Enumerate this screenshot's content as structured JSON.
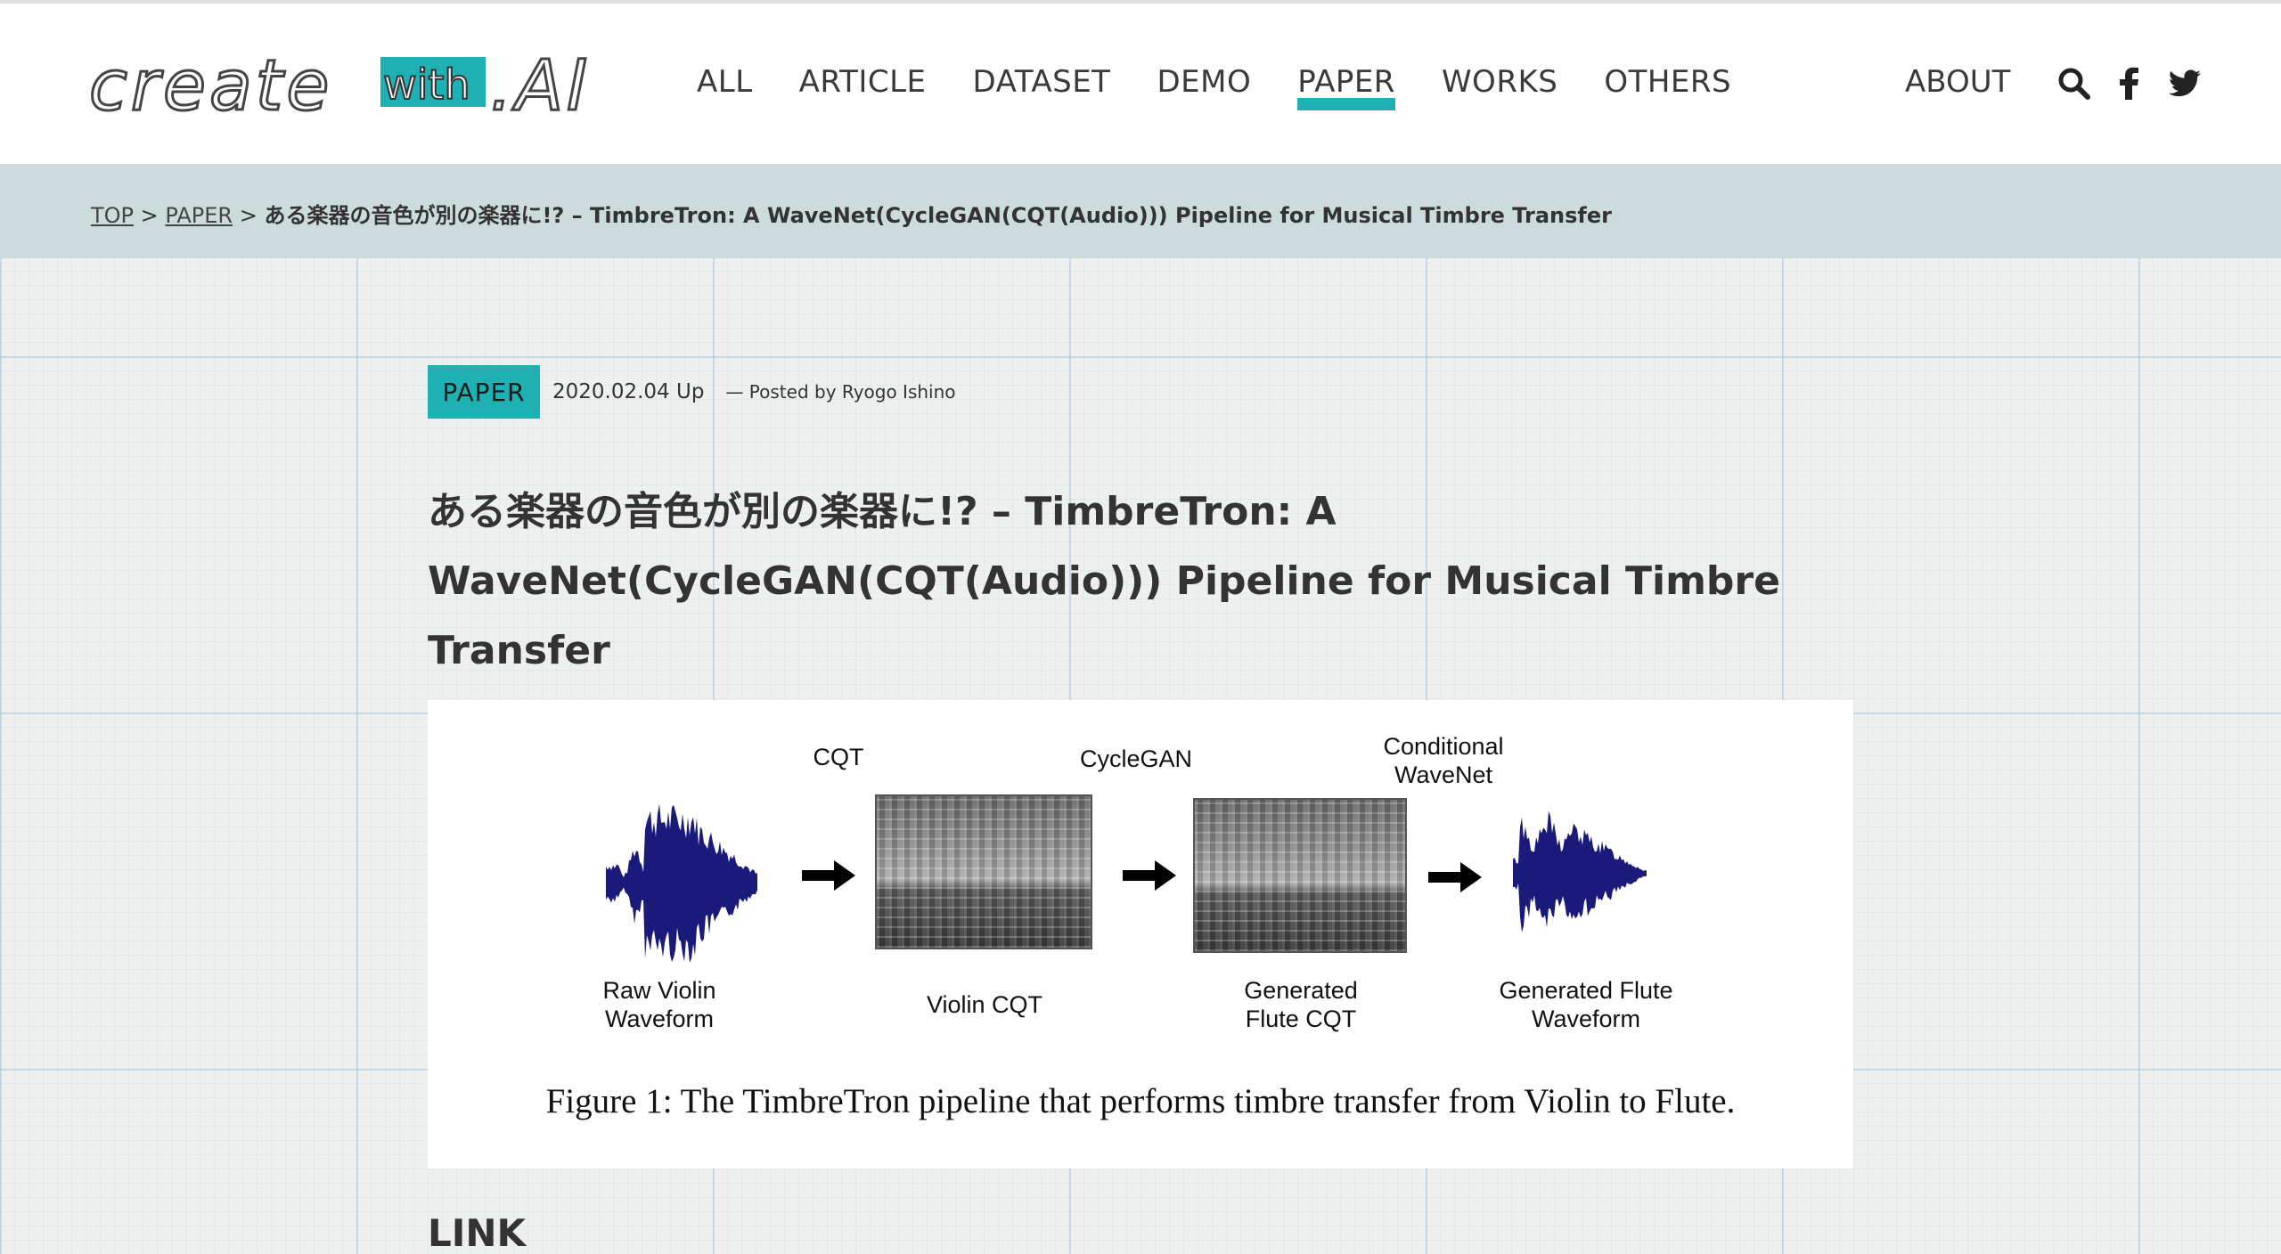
{
  "logo": {
    "part1": "create",
    "part2": "with",
    "part3": ".AI"
  },
  "nav": {
    "items": [
      {
        "label": "ALL"
      },
      {
        "label": "ARTICLE"
      },
      {
        "label": "DATASET"
      },
      {
        "label": "DEMO"
      },
      {
        "label": "PAPER",
        "active": true
      },
      {
        "label": "WORKS"
      },
      {
        "label": "OTHERS"
      }
    ],
    "about": "ABOUT",
    "icons": [
      "search-icon",
      "facebook-icon",
      "twitter-icon"
    ]
  },
  "breadcrumb": {
    "top": "TOP",
    "sep1": " > ",
    "paper": "PAPER",
    "sep2": " > ",
    "current": "ある楽器の音色が別の楽器に!? – TimbreTron: A WaveNet(CycleGAN(CQT(Audio))) Pipeline for Musical Timbre Transfer"
  },
  "article": {
    "category": "PAPER",
    "date": "2020.02.04 Up",
    "posted_by": "— Posted by Ryogo Ishino",
    "title_line1": "ある楽器の音色が別の楽器に!? – TimbreTron: A",
    "title_line2": "WaveNet(CycleGAN(CQT(Audio))) Pipeline for Musical Timbre Transfer"
  },
  "figure": {
    "label_cqt": "CQT",
    "label_cyclegan": "CycleGAN",
    "label_wavenet_1": "Conditional",
    "label_wavenet_2": "WaveNet",
    "raw_1": "Raw Violin",
    "raw_2": "Waveform",
    "violin_cqt": "Violin CQT",
    "gen_cqt_1": "Generated",
    "gen_cqt_2": "Flute CQT",
    "gen_wave_1": "Generated Flute",
    "gen_wave_2": "Waveform",
    "caption": "Figure 1: The TimbreTron pipeline that performs timbre transfer from Violin to Flute.",
    "waveform_color": "#1a1a7a"
  },
  "section": {
    "link_heading": "LINK"
  },
  "colors": {
    "accent": "#1eb0b3",
    "crumb_bg": "#ccdcdc"
  }
}
